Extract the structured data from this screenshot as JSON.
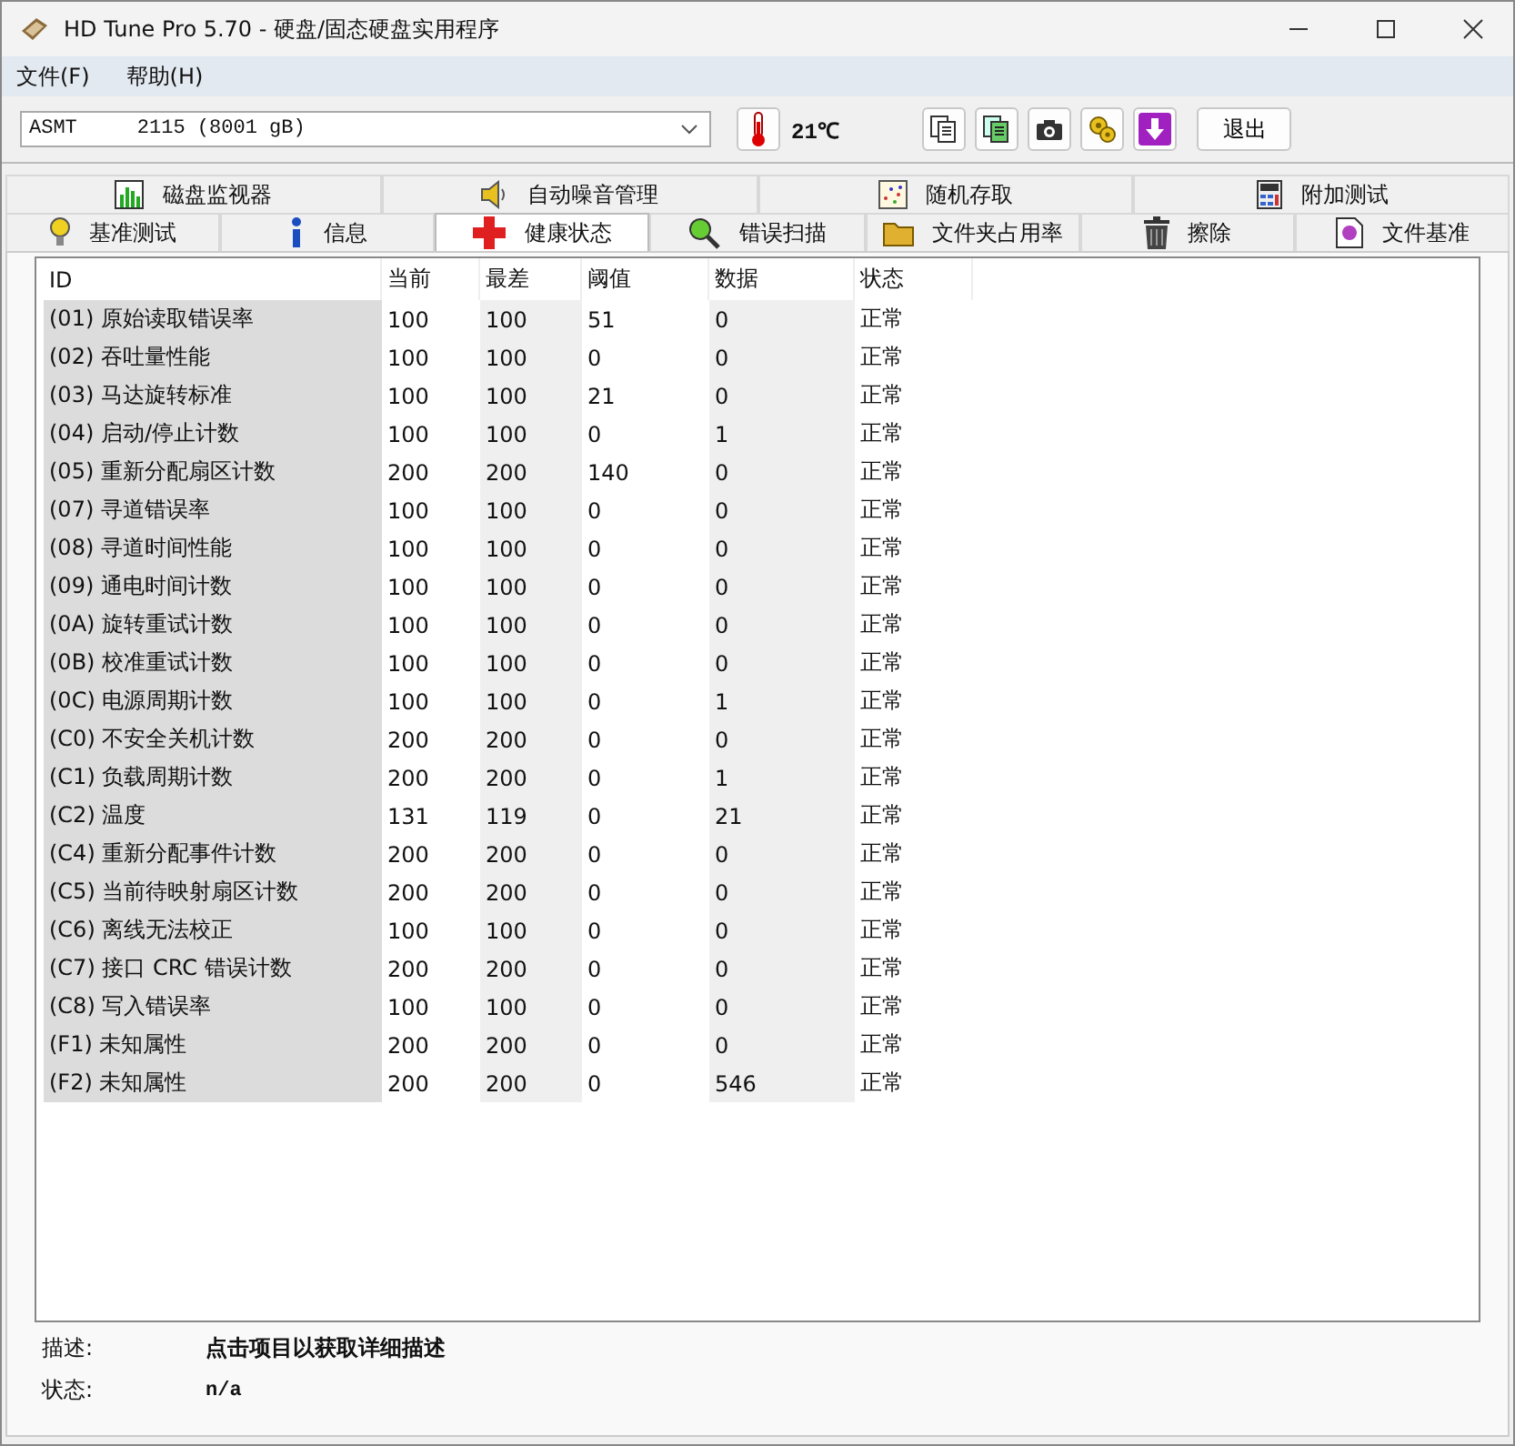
{
  "window": {
    "title": "HD Tune Pro 5.70 - 硬盘/固态硬盘实用程序"
  },
  "menu": [
    "文件(F)",
    "帮助(H)"
  ],
  "toolbar": {
    "drive": "ASMT     2115 (8001 gB)",
    "temperature": "21℃",
    "exit_button": "退出"
  },
  "tabs_top": [
    {
      "label": "磁盘监视器",
      "selected": false
    },
    {
      "label": "自动噪音管理",
      "selected": false
    },
    {
      "label": "随机存取",
      "selected": false
    },
    {
      "label": "附加测试",
      "selected": false
    }
  ],
  "tabs_bottom": [
    {
      "label": "基准测试",
      "selected": false
    },
    {
      "label": "信息",
      "selected": false
    },
    {
      "label": "健康状态",
      "selected": true
    },
    {
      "label": "错误扫描",
      "selected": false
    },
    {
      "label": "文件夹占用率",
      "selected": false
    },
    {
      "label": "擦除",
      "selected": false
    },
    {
      "label": "文件基准",
      "selected": false
    }
  ],
  "table": {
    "columns": [
      "ID",
      "当前",
      "最差",
      "阈值",
      "数据",
      "状态"
    ],
    "rows": [
      [
        "(01) 原始读取错误率",
        "100",
        "100",
        "51",
        "0",
        "正常"
      ],
      [
        "(02) 吞吐量性能",
        "100",
        "100",
        "0",
        "0",
        "正常"
      ],
      [
        "(03) 马达旋转标准",
        "100",
        "100",
        "21",
        "0",
        "正常"
      ],
      [
        "(04) 启动/停止计数",
        "100",
        "100",
        "0",
        "1",
        "正常"
      ],
      [
        "(05) 重新分配扇区计数",
        "200",
        "200",
        "140",
        "0",
        "正常"
      ],
      [
        "(07) 寻道错误率",
        "100",
        "100",
        "0",
        "0",
        "正常"
      ],
      [
        "(08) 寻道时间性能",
        "100",
        "100",
        "0",
        "0",
        "正常"
      ],
      [
        "(09) 通电时间计数",
        "100",
        "100",
        "0",
        "0",
        "正常"
      ],
      [
        "(0A) 旋转重试计数",
        "100",
        "100",
        "0",
        "0",
        "正常"
      ],
      [
        "(0B) 校准重试计数",
        "100",
        "100",
        "0",
        "0",
        "正常"
      ],
      [
        "(0C) 电源周期计数",
        "100",
        "100",
        "0",
        "1",
        "正常"
      ],
      [
        "(C0) 不安全关机计数",
        "200",
        "200",
        "0",
        "0",
        "正常"
      ],
      [
        "(C1) 负载周期计数",
        "200",
        "200",
        "0",
        "1",
        "正常"
      ],
      [
        "(C2) 温度",
        "131",
        "119",
        "0",
        "21",
        "正常"
      ],
      [
        "(C4) 重新分配事件计数",
        "200",
        "200",
        "0",
        "0",
        "正常"
      ],
      [
        "(C5) 当前待映射扇区计数",
        "200",
        "200",
        "0",
        "0",
        "正常"
      ],
      [
        "(C6) 离线无法校正",
        "100",
        "100",
        "0",
        "0",
        "正常"
      ],
      [
        "(C7) 接口 CRC 错误计数",
        "200",
        "200",
        "0",
        "0",
        "正常"
      ],
      [
        "(C8) 写入错误率",
        "100",
        "100",
        "0",
        "0",
        "正常"
      ],
      [
        "(F1) 未知属性",
        "200",
        "200",
        "0",
        "0",
        "正常"
      ],
      [
        "(F2) 未知属性",
        "200",
        "200",
        "0",
        "546",
        "正常"
      ]
    ]
  },
  "details": [
    {
      "label": "描述:",
      "value": "点击项目以获取详细描述"
    },
    {
      "label": "状态:",
      "value": "n/a"
    }
  ]
}
